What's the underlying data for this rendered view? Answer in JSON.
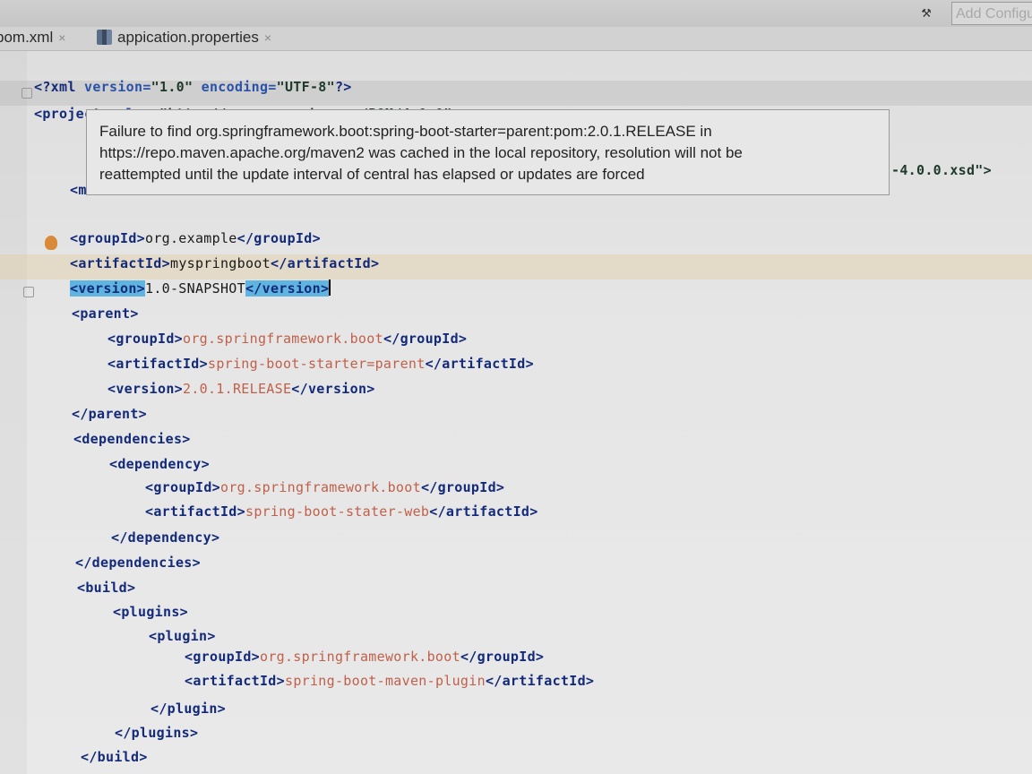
{
  "toolbar": {
    "build_icon": "hammer-icon",
    "run_config": "Add Configu"
  },
  "tabs": [
    {
      "label": "pom.xml",
      "close": "×"
    },
    {
      "label": "appication.properties",
      "close": "×"
    }
  ],
  "tooltip": {
    "lines": [
      "Failure to find org.springframework.boot:spring-boot-starter=parent:pom:2.0.1.RELEASE in",
      "https://repo.maven.apache.org/maven2 was cached in the local repository, resolution will not be",
      "reattempted until the update interval of central has elapsed or updates are forced"
    ]
  },
  "code": {
    "decl_open": "<?xml ",
    "decl_version_attr": "version=",
    "decl_version_val": "\"1.0\"",
    "decl_enc_attr": " encoding=",
    "decl_enc_val": "\"UTF-8\"",
    "decl_close": "?>",
    "project_open": "<project ",
    "project_attr": "xmlns=",
    "project_val": "\"http://maven.apache.org/POM/4.0.0\"",
    "hidden_start": "<m",
    "schema_tail": "-4.0.0.xsd\">",
    "groupId_open": "<groupId>",
    "groupId_close": "</groupId>",
    "artifactId_open": "<artifactId>",
    "artifactId_close": "</artifactId>",
    "version_open": "<version>",
    "version_close": "</version>",
    "parent_open": "<parent>",
    "parent_close": "</parent>",
    "dependencies_open": "<dependencies>",
    "dependencies_close": "</dependencies>",
    "dependency_open": "<dependency>",
    "dependency_close": "</dependency>",
    "build_open": "<build>",
    "build_close": "</build>",
    "plugins_open": "<plugins>",
    "plugins_close": "</plugins>",
    "plugin_open": "<plugin>",
    "plugin_close": "</plugin>",
    "project_groupId": "org.example",
    "project_artifactId": "myspringboot",
    "project_version": "1.0-SNAPSHOT",
    "parent_groupId": "org.springframework.boot",
    "parent_artifactId": "spring-boot-starter=parent",
    "parent_version": "2.0.1.RELEASE",
    "dep_groupId": "org.springframework.boot",
    "dep_artifactId": "spring-boot-stater-web",
    "plugin_groupId": "org.springframework.boot",
    "plugin_artifactId": "spring-boot-maven-plugin"
  },
  "gutter": {
    "intention_icon": "lightbulb-icon",
    "fold_icon": "fold-marker-icon"
  }
}
